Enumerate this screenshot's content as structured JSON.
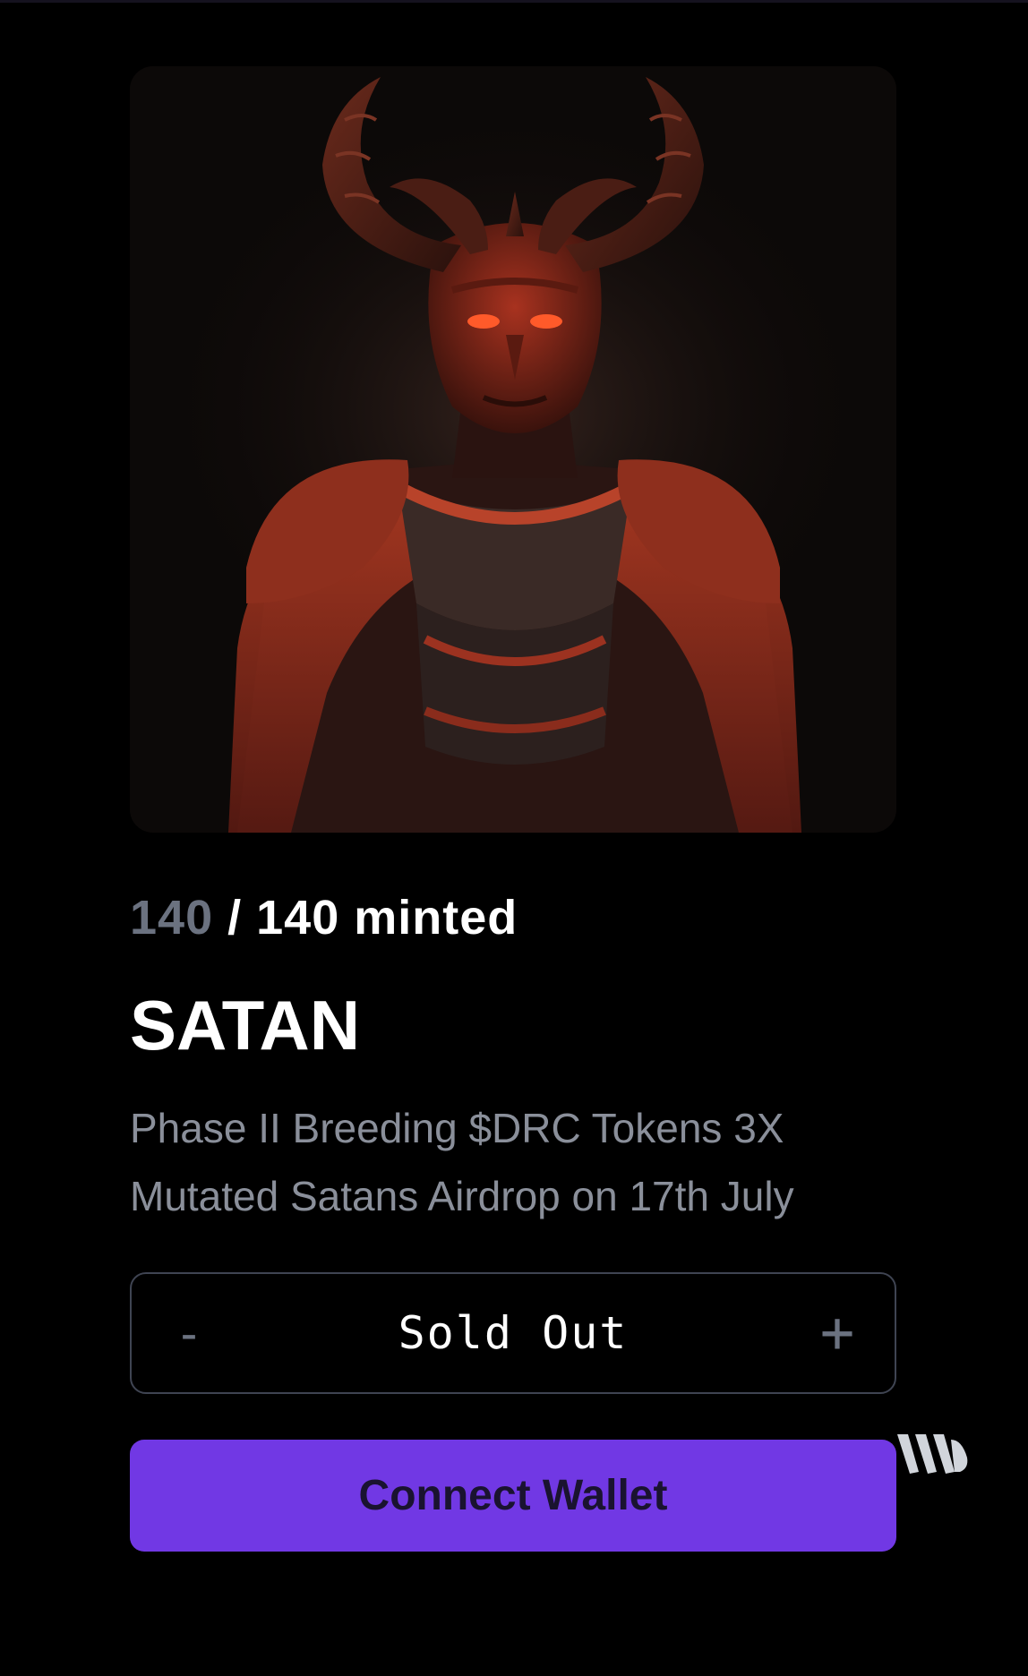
{
  "mint": {
    "minted": "140",
    "separator": " / ",
    "total_label": "140 minted"
  },
  "collection": {
    "title": "SATAN",
    "description": "Phase II Breeding $DRC Tokens 3X Mutated Satans Airdrop on 17th July"
  },
  "quantity": {
    "minus_label": "-",
    "status": "Sold Out",
    "plus_label": "+"
  },
  "actions": {
    "connect_label": "Connect Wallet"
  },
  "colors": {
    "background": "#000000",
    "accent": "#7138e4",
    "muted_text": "#8a8f9a",
    "minted_count": "#6b7280"
  },
  "icons": {
    "artwork": "horned-demon-illustration",
    "brand": "triple-w-logo-icon"
  }
}
